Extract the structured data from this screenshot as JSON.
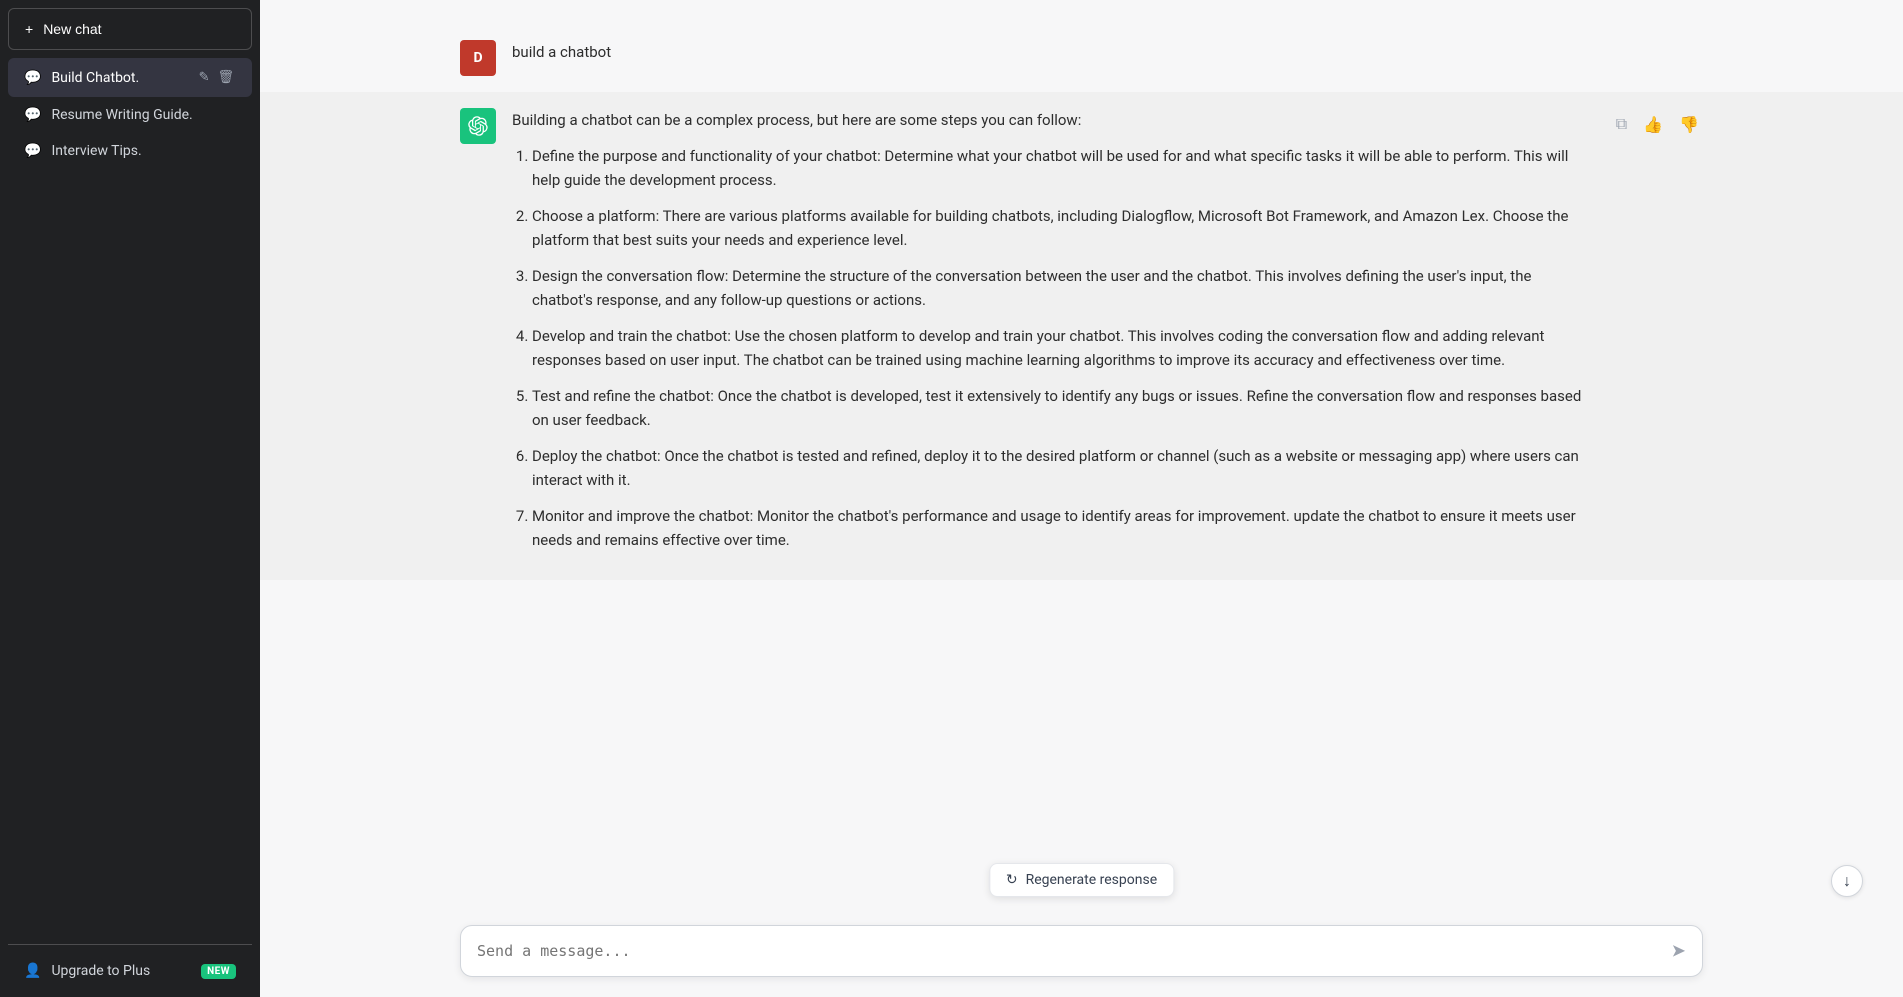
{
  "sidebar": {
    "new_chat_label": "New chat",
    "chat_items": [
      {
        "id": "build-chatbot",
        "label": "Build Chatbot.",
        "active": true
      },
      {
        "id": "resume-writing",
        "label": "Resume Writing Guide.",
        "active": false
      },
      {
        "id": "interview-tips",
        "label": "Interview Tips.",
        "active": false
      }
    ],
    "upgrade_label": "Upgrade to Plus",
    "new_badge": "NEW"
  },
  "header": {
    "user_initial": "D",
    "user_message": "build a chatbot"
  },
  "assistant": {
    "avatar_symbol": "✦",
    "intro": "Building a chatbot can be a complex process, but here are some steps you can follow:",
    "steps": [
      {
        "num": 1,
        "text": "Define the purpose and functionality of your chatbot: Determine what your chatbot will be used for and what specific tasks it will be able to perform. This will help guide the development process."
      },
      {
        "num": 2,
        "text": "Choose a platform: There are various platforms available for building chatbots, including Dialogflow, Microsoft Bot Framework, and Amazon Lex. Choose the platform that best suits your needs and experience level."
      },
      {
        "num": 3,
        "text": "Design the conversation flow: Determine the structure of the conversation between the user and the chatbot. This involves defining the user's input, the chatbot's response, and any follow-up questions or actions."
      },
      {
        "num": 4,
        "text": "Develop and train the chatbot: Use the chosen platform to develop and train your chatbot. This involves coding the conversation flow and adding relevant responses based on user input. The chatbot can be trained using machine learning algorithms to improve its accuracy and effectiveness over time."
      },
      {
        "num": 5,
        "text": "Test and refine the chatbot: Once the chatbot is developed, test it extensively to identify any bugs or issues. Refine the conversation flow and responses based on user feedback."
      },
      {
        "num": 6,
        "text": "Deploy the chatbot: Once the chatbot is tested and refined, deploy it to the desired platform or channel (such as a website or messaging app) where users can interact with it."
      },
      {
        "num": 7,
        "text": "Monitor and improve the chatbot: Monitor the chatbot's performance and usage to identify areas for improvement. update the chatbot to ensure it meets user needs and remains effective over time."
      }
    ]
  },
  "input": {
    "placeholder": "Send a message...",
    "current_value": ""
  },
  "regenerate": {
    "label": "Regenerate response"
  },
  "icons": {
    "plus": "+",
    "chat": "💬",
    "edit": "✏",
    "delete": "🗑",
    "copy": "⧉",
    "thumbup": "👍",
    "thumbdown": "👎",
    "send": "➤",
    "scroll_down": "↓",
    "user_icon": "👤",
    "regen": "↺"
  }
}
